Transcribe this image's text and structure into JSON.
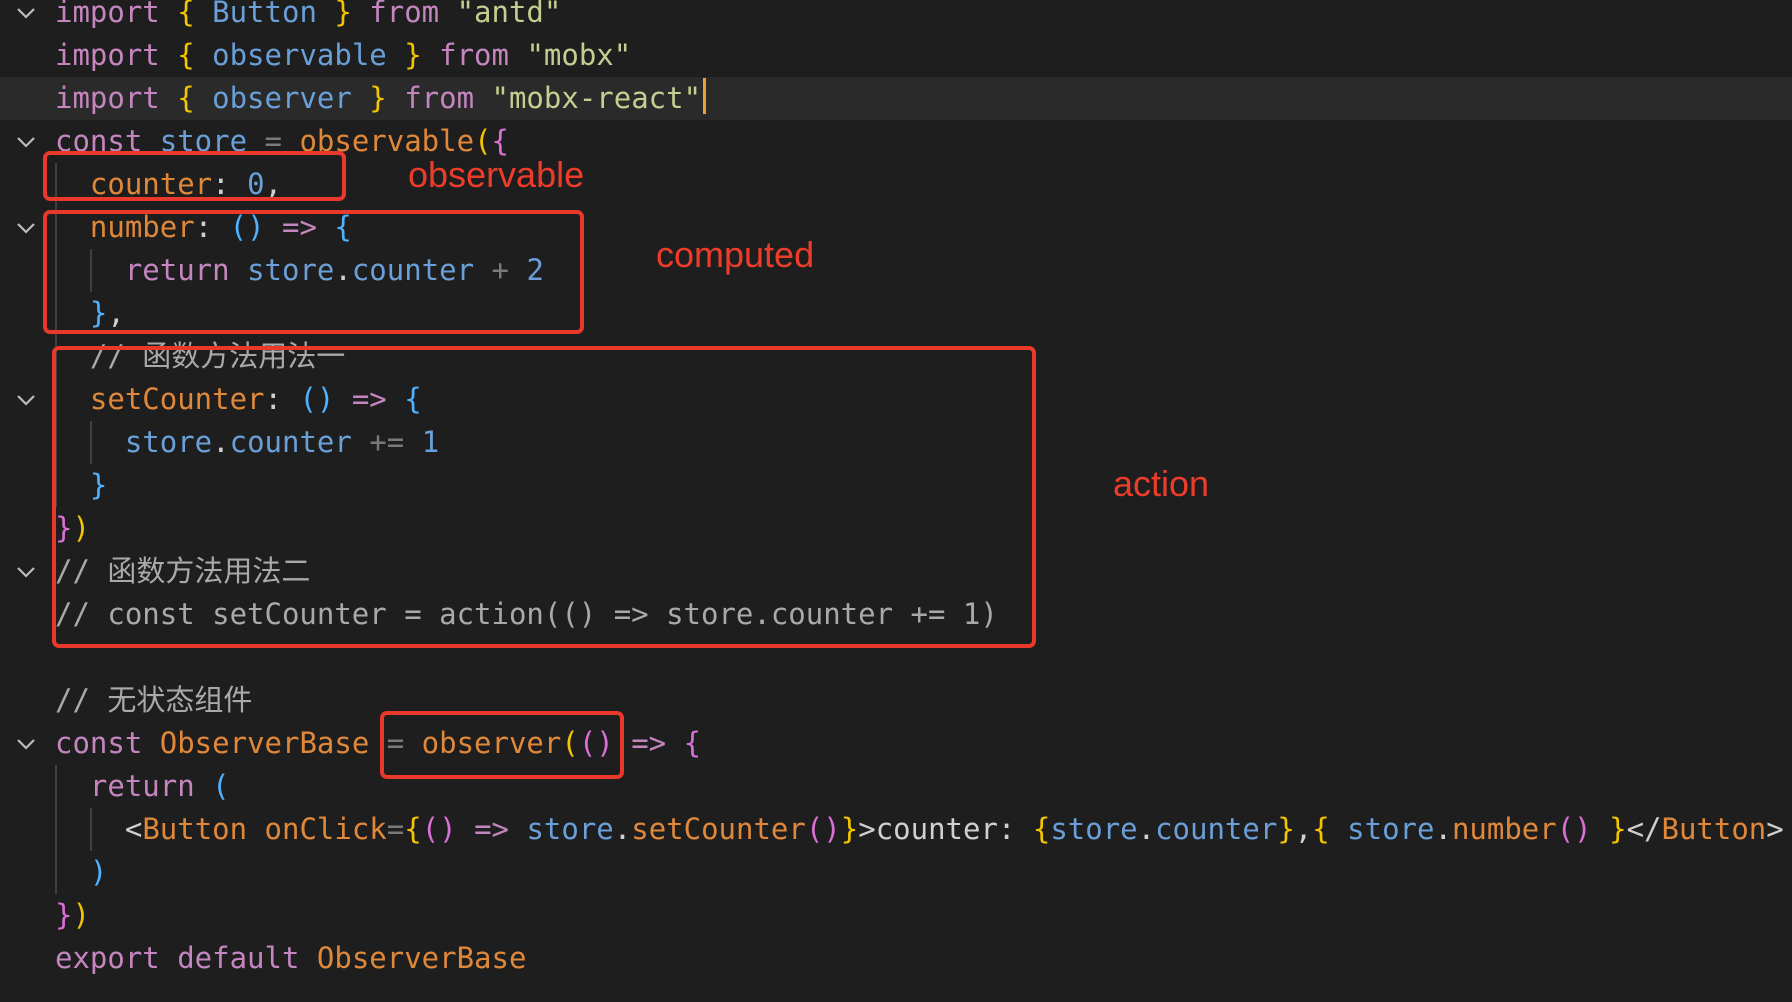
{
  "lines": [
    [
      [
        "import ",
        "kw"
      ],
      [
        "{ ",
        "br1"
      ],
      [
        "Button ",
        "var"
      ],
      [
        "} ",
        "br1"
      ],
      [
        "from ",
        "kw"
      ],
      [
        "\"antd\"",
        "str"
      ]
    ],
    [
      [
        "import ",
        "kw"
      ],
      [
        "{ ",
        "br1"
      ],
      [
        "observable ",
        "var"
      ],
      [
        "} ",
        "br1"
      ],
      [
        "from ",
        "kw"
      ],
      [
        "\"mobx\"",
        "str"
      ]
    ],
    [
      [
        "import ",
        "kw"
      ],
      [
        "{ ",
        "br1"
      ],
      [
        "observer ",
        "var"
      ],
      [
        "} ",
        "br1"
      ],
      [
        "from ",
        "kw"
      ],
      [
        "\"mobx-react\"",
        "str"
      ]
    ],
    [
      [
        "const ",
        "kw"
      ],
      [
        "store ",
        "var"
      ],
      [
        "= ",
        "op"
      ],
      [
        "observable",
        "fn"
      ],
      [
        "(",
        "br1"
      ],
      [
        "{",
        "br2"
      ]
    ],
    [
      [
        "  counter",
        "prop"
      ],
      [
        ": ",
        "punc"
      ],
      [
        "0",
        "num"
      ],
      [
        ",",
        "punc"
      ]
    ],
    [
      [
        "  number",
        "prop"
      ],
      [
        ": ",
        "punc"
      ],
      [
        "() ",
        "br3"
      ],
      [
        "=> ",
        "kw"
      ],
      [
        "{",
        "br3"
      ]
    ],
    [
      [
        "    return ",
        "kw"
      ],
      [
        "store",
        "var"
      ],
      [
        ".",
        "punc"
      ],
      [
        "counter ",
        "var"
      ],
      [
        "+ ",
        "op"
      ],
      [
        "2",
        "num"
      ]
    ],
    [
      [
        "  }",
        "br3"
      ],
      [
        ",",
        "punc"
      ]
    ],
    [
      [
        "  // 函数方法用法一",
        "cmt"
      ]
    ],
    [
      [
        "  setCounter",
        "prop"
      ],
      [
        ": ",
        "punc"
      ],
      [
        "() ",
        "br3"
      ],
      [
        "=> ",
        "kw"
      ],
      [
        "{",
        "br3"
      ]
    ],
    [
      [
        "    store",
        "var"
      ],
      [
        ".",
        "punc"
      ],
      [
        "counter ",
        "var"
      ],
      [
        "+= ",
        "op"
      ],
      [
        "1",
        "num"
      ]
    ],
    [
      [
        "  }",
        "br3"
      ]
    ],
    [
      [
        "}",
        "br2"
      ],
      [
        ")",
        "br1"
      ]
    ],
    [
      [
        "// 函数方法用法二",
        "cmt"
      ]
    ],
    [
      [
        "// const setCounter = action(() => store.counter += 1)",
        "cmt"
      ]
    ],
    [
      [
        "",
        "cmt"
      ]
    ],
    [
      [
        "// 无状态组件",
        "cmt"
      ]
    ],
    [
      [
        "const ",
        "kw"
      ],
      [
        "ObserverBase ",
        "fn"
      ],
      [
        "= ",
        "op"
      ],
      [
        "observer",
        "fn"
      ],
      [
        "(",
        "br1"
      ],
      [
        "()",
        "br2"
      ],
      [
        " => ",
        "kw"
      ],
      [
        "{",
        "br2"
      ]
    ],
    [
      [
        "  return ",
        "kw"
      ],
      [
        "(",
        "br3"
      ]
    ],
    [
      [
        "    <",
        "punc"
      ],
      [
        "Button ",
        "fn"
      ],
      [
        "onClick",
        "prop"
      ],
      [
        "=",
        "op"
      ],
      [
        "{",
        "br1"
      ],
      [
        "()",
        "br2"
      ],
      [
        " => ",
        "kw"
      ],
      [
        "store",
        "var"
      ],
      [
        ".",
        "punc"
      ],
      [
        "setCounter",
        "fn"
      ],
      [
        "()",
        "br2"
      ],
      [
        "}",
        "br1"
      ],
      [
        ">counter: ",
        "punc"
      ],
      [
        "{",
        "br1"
      ],
      [
        "store",
        "var"
      ],
      [
        ".",
        "punc"
      ],
      [
        "counter",
        "var"
      ],
      [
        "}",
        "br1"
      ],
      [
        ",",
        "punc"
      ],
      [
        "{ ",
        "br1"
      ],
      [
        "store",
        "var"
      ],
      [
        ".",
        "punc"
      ],
      [
        "number",
        "fn"
      ],
      [
        "() ",
        "br2"
      ],
      [
        "}",
        "br1"
      ],
      [
        "</",
        "punc"
      ],
      [
        "Button",
        "fn"
      ],
      [
        ">",
        "punc"
      ]
    ],
    [
      [
        "  )",
        "br3"
      ]
    ],
    [
      [
        "}",
        "br2"
      ],
      [
        ")",
        "br1"
      ]
    ],
    [
      [
        "export ",
        "kw"
      ],
      [
        "default ",
        "kw"
      ],
      [
        "ObserverBase",
        "fn"
      ]
    ]
  ],
  "annotations": {
    "observable": "observable",
    "computed": "computed",
    "action": "action"
  },
  "colors": {
    "accent": "#e8392b",
    "background": "#1e1e1e"
  },
  "icons": {
    "fold": "chevron-down-icon"
  }
}
